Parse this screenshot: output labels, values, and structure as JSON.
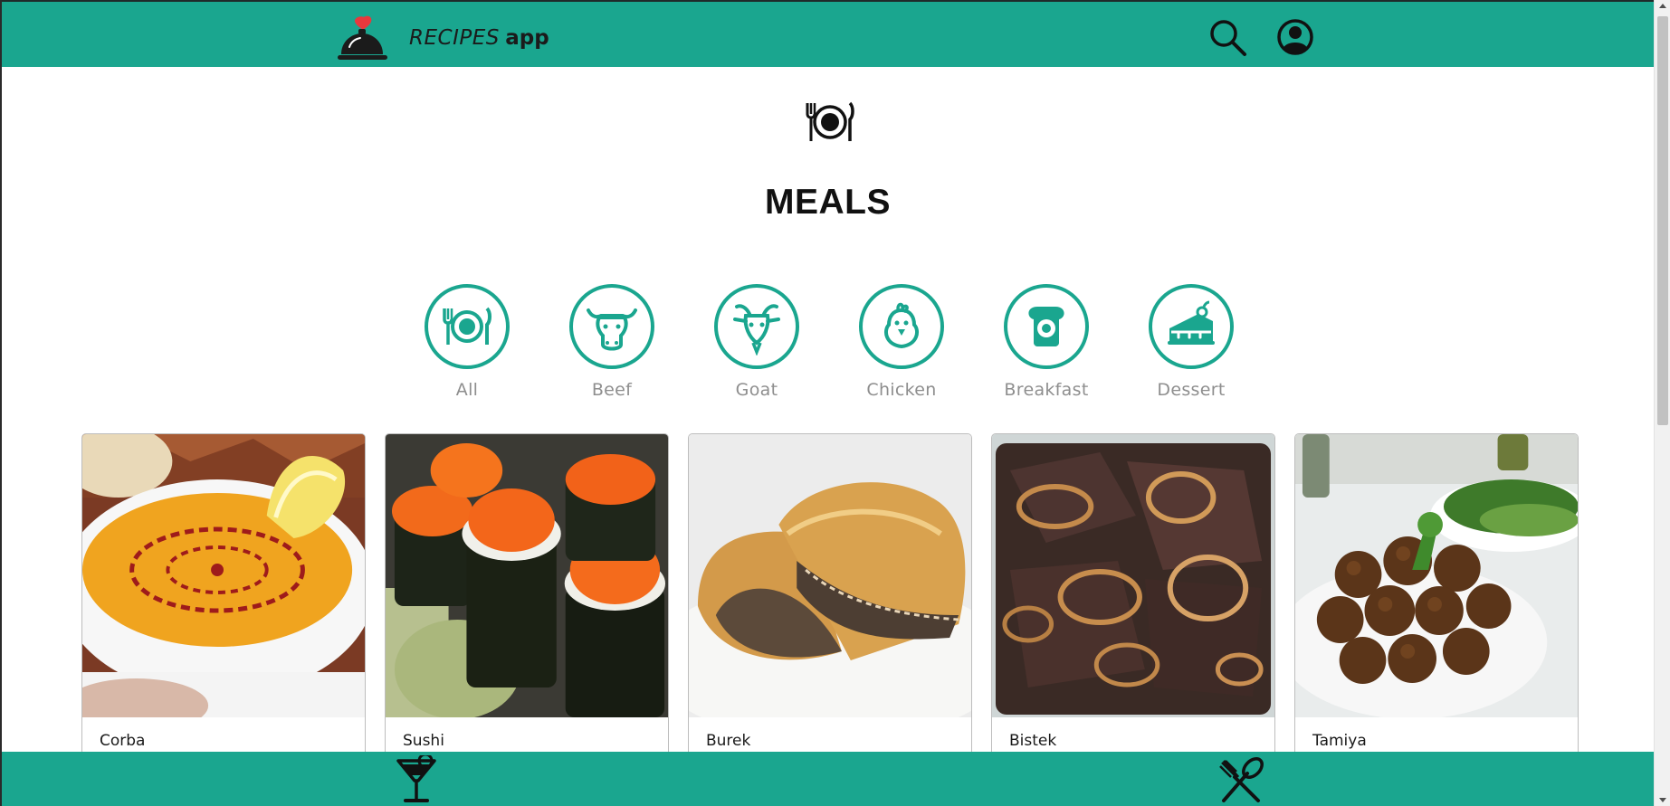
{
  "app": {
    "name_light": "RECIPES",
    "name_bold": "app"
  },
  "header": {
    "logo_icon": "serving-cloche-heart-icon",
    "search_icon": "search-icon",
    "profile_icon": "profile-icon"
  },
  "page": {
    "icon": "plate-fork-knife-icon",
    "title": "MEALS"
  },
  "categories": [
    {
      "label": "All",
      "icon": "plate-fork-knife-icon"
    },
    {
      "label": "Beef",
      "icon": "cow-icon"
    },
    {
      "label": "Goat",
      "icon": "goat-icon"
    },
    {
      "label": "Chicken",
      "icon": "chicken-icon"
    },
    {
      "label": "Breakfast",
      "icon": "toast-egg-icon"
    },
    {
      "label": "Dessert",
      "icon": "cake-icon"
    }
  ],
  "recipes": [
    {
      "name": "Corba"
    },
    {
      "name": "Sushi"
    },
    {
      "name": "Burek"
    },
    {
      "name": "Bistek"
    },
    {
      "name": "Tamiya"
    }
  ],
  "footer": {
    "drinks_icon": "cocktail-icon",
    "meals_icon": "fork-spoon-icon"
  },
  "colors": {
    "accent": "#1aa68f",
    "text_dark": "#111111",
    "label_gray": "#8e8e8e"
  }
}
